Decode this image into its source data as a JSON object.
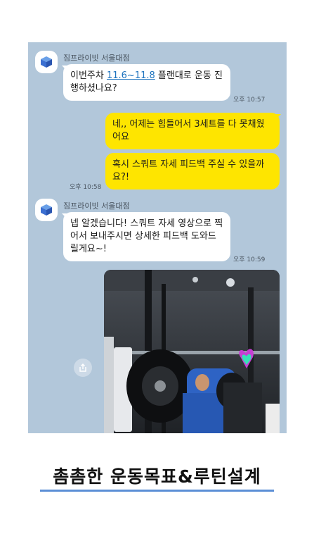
{
  "chat": {
    "messages": [
      {
        "sender": "짐프라이빗 서울대점",
        "lines": [
          "이번주차 ",
          "11.6~11.8",
          " 플랜대로 운동 진",
          "행하셨나요?"
        ],
        "time": "오후 10:57"
      },
      {
        "line1": "네,, 어제는 힘들어서 3세트를 다 못채웠",
        "line2": "어요"
      },
      {
        "line1": "혹시 스쿼트 자세 피드백 주실 수 있을까",
        "line2": "요?!",
        "time": "오후 10:58"
      },
      {
        "sender": "짐프라이빗 서울대점",
        "line1": "넵 알겠습니다! 스쿼트 자세 영상으로 찍",
        "line2": "어서 보내주시면 상세한 피드백 도와드",
        "line3": "릴게요~!",
        "time": "오후 10:59"
      }
    ]
  },
  "caption": "촘촘한 운동목표&루틴설계",
  "icons": {
    "avatar": "cube-logo-icon",
    "share": "share-icon",
    "photo": "gym-squat-photo"
  },
  "colors": {
    "chat_bg": "#b2c7da",
    "incoming": "#ffffff",
    "outgoing": "#fee500",
    "accent": "#5b8fd6"
  }
}
